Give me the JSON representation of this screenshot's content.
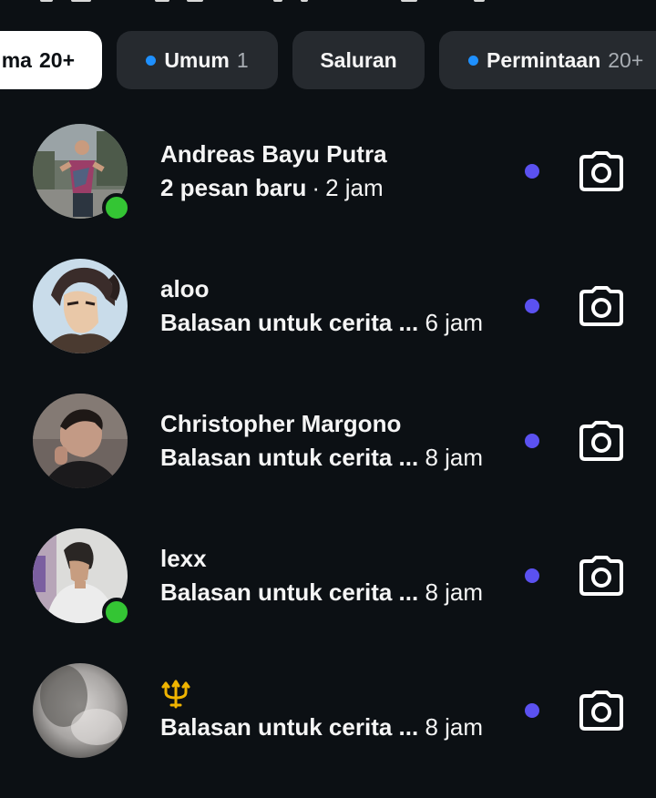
{
  "tabs": [
    {
      "label": "ma",
      "count": "20+",
      "active": true,
      "dot": false
    },
    {
      "label": "Umum",
      "count": "1",
      "active": false,
      "dot": true
    },
    {
      "label": "Saluran",
      "count": "",
      "active": false,
      "dot": false
    },
    {
      "label": "Permintaan",
      "count": "20+",
      "active": false,
      "dot": true
    }
  ],
  "conversations": [
    {
      "name": "Andreas Bayu Putra",
      "preview": "2 pesan baru",
      "separator": "·",
      "time": "2 jam",
      "online": true,
      "unread": true,
      "avatar_icon": "avatar-photo"
    },
    {
      "name": "aloo",
      "preview": "Balasan untuk cerita ...",
      "separator": "",
      "time": "6 jam",
      "online": false,
      "unread": true,
      "avatar_icon": "anime-avatar"
    },
    {
      "name": "Christopher Margono",
      "preview": "Balasan untuk cerita ...",
      "separator": "",
      "time": "8 jam",
      "online": false,
      "unread": true,
      "avatar_icon": "avatar-photo"
    },
    {
      "name": "lexx",
      "preview": "Balasan untuk cerita ...",
      "separator": "",
      "time": "8 jam",
      "online": true,
      "unread": true,
      "avatar_icon": "avatar-photo"
    },
    {
      "name": "",
      "name_icon": "trident-emoji",
      "preview": "Balasan untuk cerita ...",
      "separator": "",
      "time": "8 jam",
      "online": false,
      "unread": true,
      "avatar_icon": "blurred-avatar"
    }
  ],
  "colors": {
    "background": "#0c1014",
    "tab_bg": "#262a2f",
    "active_tab_bg": "#ffffff",
    "tab_dot": "#1e90ff",
    "online": "#34c534",
    "unread": "#5b51f0",
    "trident": "#f0b400"
  },
  "icons": {
    "row_action": "camera-icon",
    "tab_indicator": "dot-icon"
  }
}
